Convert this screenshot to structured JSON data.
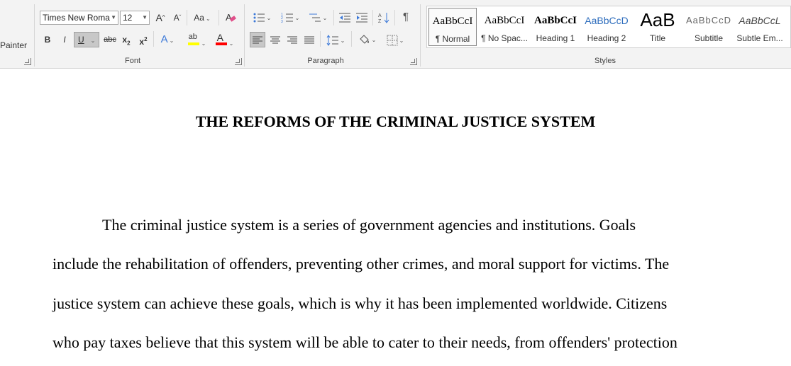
{
  "clipboard": {
    "painter_label": "Painter"
  },
  "font": {
    "group_label": "Font",
    "font_name": "Times New Roma",
    "font_size": "12",
    "grow_label": "A",
    "shrink_label": "A",
    "case_label": "Aa",
    "bold_label": "B",
    "italic_label": "I",
    "underline_label": "U",
    "strike_label": "abc",
    "subscript_label": "x",
    "subscript_sub": "2",
    "superscript_label": "x",
    "superscript_sup": "2",
    "effects_label": "A",
    "highlight_label": "ab",
    "fontcolor_label": "A",
    "highlight_color": "#ffff00",
    "font_color": "#ff0000"
  },
  "paragraph": {
    "group_label": "Paragraph",
    "pilcrow": "¶"
  },
  "styles": {
    "group_label": "Styles",
    "items": [
      {
        "sample": "AaBbCcI",
        "name": "¶ Normal"
      },
      {
        "sample": "AaBbCcI",
        "name": "¶ No Spac..."
      },
      {
        "sample": "AaBbCcI",
        "name": "Heading 1"
      },
      {
        "sample": "AaBbCcD",
        "name": "Heading 2"
      },
      {
        "sample": "AaB",
        "name": "Title"
      },
      {
        "sample": "AaBbCcD",
        "name": "Subtitle"
      },
      {
        "sample": "AaBbCcL",
        "name": "Subtle Em..."
      }
    ]
  },
  "document": {
    "title": "THE REFORMS OF THE CRIMINAL JUSTICE SYSTEM",
    "lines": [
      "The criminal justice system is a series of government agencies and institutions. Goals",
      "include the rehabilitation of offenders, preventing other crimes, and moral support for victims. The",
      "justice system can achieve these goals, which is why it has been implemented worldwide. Citizens",
      "who pay taxes believe that this system will be able to cater to their needs, from offenders' protection"
    ]
  }
}
